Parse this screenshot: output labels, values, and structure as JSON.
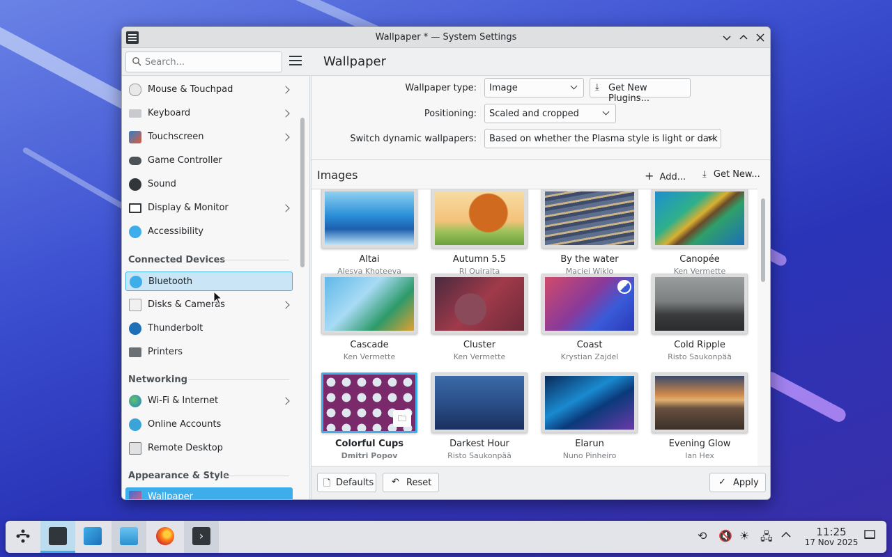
{
  "window": {
    "title": "Wallpaper * — System Settings"
  },
  "sidebar": {
    "search_placeholder": "Search...",
    "items": [
      {
        "label": "Mouse & Touchpad",
        "icon": "mouse-icon",
        "chevron": true
      },
      {
        "label": "Keyboard",
        "icon": "keyboard-icon",
        "chevron": true
      },
      {
        "label": "Touchscreen",
        "icon": "touchscreen-icon",
        "chevron": true
      },
      {
        "label": "Game Controller",
        "icon": "game-controller-icon",
        "chevron": false
      },
      {
        "label": "Sound",
        "icon": "sound-icon",
        "chevron": false
      },
      {
        "label": "Display & Monitor",
        "icon": "display-icon",
        "chevron": true
      },
      {
        "label": "Accessibility",
        "icon": "accessibility-icon",
        "chevron": false
      }
    ],
    "section_connected": "Connected Devices",
    "connected_items": [
      {
        "label": "Bluetooth",
        "icon": "bluetooth-icon",
        "chevron": false
      },
      {
        "label": "Disks & Cameras",
        "icon": "disk-icon",
        "chevron": true
      },
      {
        "label": "Thunderbolt",
        "icon": "thunderbolt-icon",
        "chevron": false
      },
      {
        "label": "Printers",
        "icon": "printer-icon",
        "chevron": false
      }
    ],
    "section_networking": "Networking",
    "networking_items": [
      {
        "label": "Wi-Fi & Internet",
        "icon": "globe-icon",
        "chevron": true
      },
      {
        "label": "Online Accounts",
        "icon": "accounts-icon",
        "chevron": false
      },
      {
        "label": "Remote Desktop",
        "icon": "remote-desktop-icon",
        "chevron": false
      }
    ],
    "section_appearance": "Appearance & Style",
    "appearance_items": [
      {
        "label": "Wallpaper",
        "icon": "wallpaper-icon",
        "chevron": false
      }
    ]
  },
  "page": {
    "title": "Wallpaper",
    "wallpaper_type_label": "Wallpaper type:",
    "wallpaper_type_value": "Image",
    "get_plugins_label": "Get New Plugins...",
    "positioning_label": "Positioning:",
    "positioning_value": "Scaled and cropped",
    "switch_label": "Switch dynamic wallpapers:",
    "switch_value": "Based on whether the Plasma style is light or dark",
    "images_heading": "Images",
    "add_label": "Add...",
    "get_new_label": "Get New...",
    "defaults_label": "Defaults",
    "reset_label": "Reset",
    "apply_label": "Apply"
  },
  "wallpapers": [
    {
      "name": "Altai",
      "author": "Alesya Khoteeva"
    },
    {
      "name": "Autumn 5.5",
      "author": "RJ Quiralta"
    },
    {
      "name": "By the water",
      "author": "Maciej Wiklo"
    },
    {
      "name": "Canopée",
      "author": "Ken Vermette"
    },
    {
      "name": "Cascade",
      "author": "Ken Vermette"
    },
    {
      "name": "Cluster",
      "author": "Ken Vermette"
    },
    {
      "name": "Coast",
      "author": "Krystian Zajdel"
    },
    {
      "name": "Cold Ripple",
      "author": "Risto Saukonpää"
    },
    {
      "name": "Colorful Cups",
      "author": "Dmitri Popov"
    },
    {
      "name": "Darkest Hour",
      "author": "Risto Saukonpää"
    },
    {
      "name": "Elarun",
      "author": "Nuno Pinheiro"
    },
    {
      "name": "Evening Glow",
      "author": "Ian Hex"
    }
  ],
  "taskbar": {
    "clock_time": "11:25",
    "clock_date": "17 Nov 2025"
  },
  "colors": {
    "accent": "#3daee9",
    "window_bg": "#eff0f1"
  }
}
